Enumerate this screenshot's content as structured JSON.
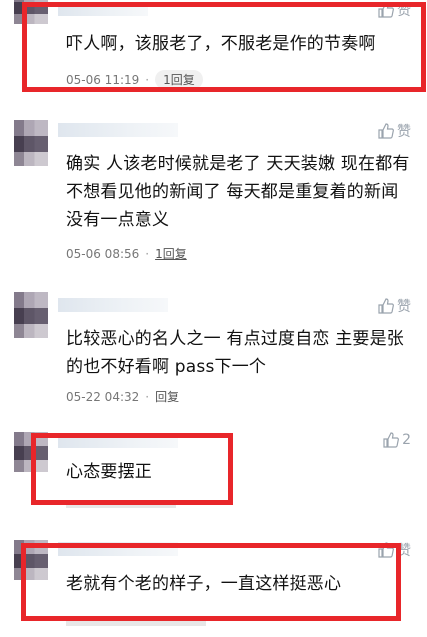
{
  "comments": [
    {
      "text": "吓人啊，该服老了，不服老是作的节奏啊",
      "time": "05-06 11:19",
      "sep": "·",
      "reply": "1回复",
      "like": "赞"
    },
    {
      "text": "确实 人该老时候就是老了 天天装嫩 现在都有不想看见他的新闻了 每天都是重复着的新闻 没有一点意义",
      "time": "05-06 08:56",
      "sep": "·",
      "reply": "1回复",
      "like": "赞"
    },
    {
      "text": "比较恶心的名人之一 有点过度自恋 主要是张的也不好看啊 pass下一个",
      "time": "05-22 04:32",
      "sep": "·",
      "reply": "回复",
      "like": "赞"
    },
    {
      "text": "心态要摆正",
      "like": "2"
    },
    {
      "text": "老就有个老的样子，一直这样挺恶心",
      "like": "赞"
    }
  ],
  "colors": {
    "highlight": "#e8262a",
    "like_icon": "#9aa3ad"
  },
  "icons": [
    "thumbs-up-icon"
  ]
}
